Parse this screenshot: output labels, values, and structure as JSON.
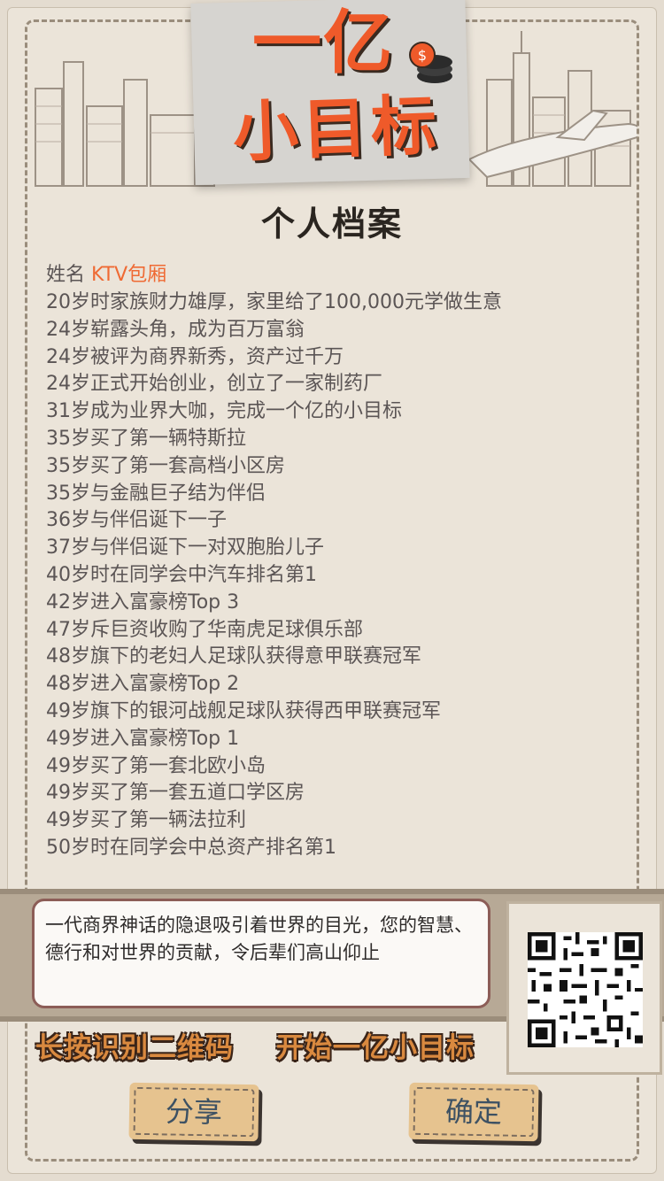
{
  "logo": {
    "line1": "一亿",
    "line2": "小目标"
  },
  "title": "个人档案",
  "profile": {
    "name_label": "姓名",
    "name_value": "KTV包厢",
    "events": [
      "20岁时家族财力雄厚，家里给了100,000元学做生意",
      "24岁崭露头角，成为百万富翁",
      "24岁被评为商界新秀，资产过千万",
      "24岁正式开始创业，创立了一家制药厂",
      "31岁成为业界大咖，完成一个亿的小目标",
      "35岁买了第一辆特斯拉",
      "35岁买了第一套高档小区房",
      "35岁与金融巨子结为伴侣",
      "36岁与伴侣诞下一子",
      "37岁与伴侣诞下一对双胞胎儿子",
      "40岁时在同学会中汽车排名第1",
      "42岁进入富豪榜Top 3",
      "47岁斥巨资收购了华南虎足球俱乐部",
      "48岁旗下的老妇人足球队获得意甲联赛冠军",
      "48岁进入富豪榜Top 2",
      "49岁旗下的银河战舰足球队获得西甲联赛冠军",
      "49岁进入富豪榜Top 1",
      "49岁买了第一套北欧小岛",
      "49岁买了第一套五道口学区房",
      "49岁买了第一辆法拉利",
      "50岁时在同学会中总资产排名第1"
    ]
  },
  "quote": "一代商界神话的隐退吸引着世界的目光，您的智慧、德行和对世界的贡献，令后辈们高山仰止",
  "hints": {
    "left": "长按识别二维码",
    "right": "开始一亿小目标"
  },
  "buttons": {
    "share": "分享",
    "confirm": "确定"
  },
  "colors": {
    "accent": "#ef5a2a",
    "name": "#ef6a34",
    "hint": "#d9893f",
    "button": "#e6c38f"
  }
}
